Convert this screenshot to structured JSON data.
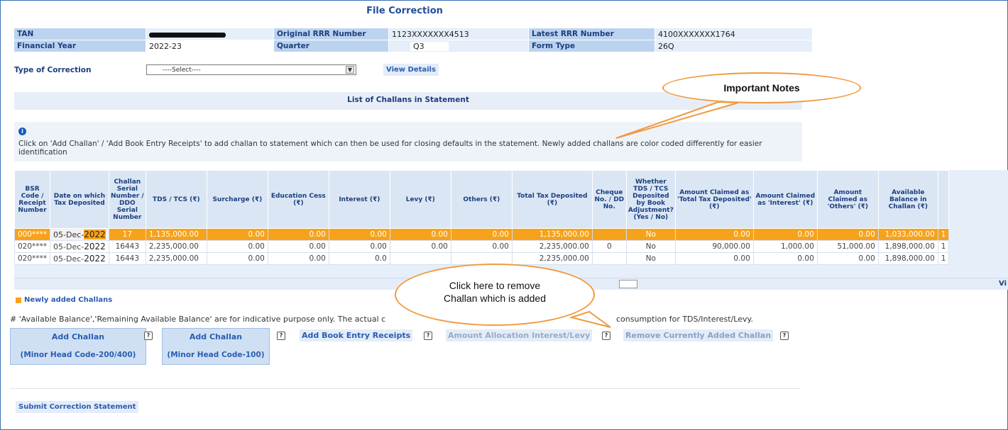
{
  "page": {
    "title": "File Correction"
  },
  "info": {
    "tan_label": "TAN",
    "tan_value": "",
    "orig_rrr_label": "Original RRR Number",
    "orig_rrr_value": "1123XXXXXXX4513",
    "latest_rrr_label": "Latest RRR Number",
    "latest_rrr_value": "4100XXXXXXX1764",
    "fy_label": "Financial Year",
    "fy_value": "2022-23",
    "quarter_label": "Quarter",
    "quarter_value": "Q3",
    "form_type_label": "Form Type",
    "form_type_value": "26Q"
  },
  "correction": {
    "label": "Type of Correction",
    "select_value": "----Select----",
    "view_details": "View Details"
  },
  "challan_header": "List of Challans in Statement",
  "note": "Click on 'Add Challan' / 'Add Book Entry Receipts' to add challan to statement which can then be used for closing defaults in the statement. Newly added challans are color coded differently for easier identification",
  "table": {
    "headers": [
      "BSR Code / Receipt Number",
      "Date on which Tax Deposited",
      "Challan Serial Number / DDO Serial Number",
      "TDS / TCS (₹)",
      "Surcharge (₹)",
      "Education Cess (₹)",
      "Interest (₹)",
      "Levy (₹)",
      "Others (₹)",
      "Total Tax Deposited (₹)",
      "Cheque No. / DD No.",
      "Whether TDS / TCS Deposited by Book Adjustment? (Yes / No)",
      "Amount Claimed as 'Total Tax Deposited' (₹)",
      "Amount Claimed as 'Interest' (₹)",
      "Amount Claimed as 'Others' (₹)",
      "Available Balance in Challan (₹)"
    ],
    "rows": [
      {
        "bsr": "000****",
        "date": "05-Dec-",
        "year": "2022",
        "serial": "17",
        "tds": "1,135,000.00",
        "surcharge": "0.00",
        "cess": "0.00",
        "interest": "0.00",
        "levy": "0.00",
        "others": "0.00",
        "total": "1,135,000.00",
        "cheque": "",
        "book": "No",
        "claimed_total": "0.00",
        "claimed_interest": "0.00",
        "claimed_others": "0.00",
        "available": "1,033,000.00",
        "extra": "1"
      },
      {
        "bsr": "020****",
        "date": "05-Dec-",
        "year": "2022",
        "serial": "16443",
        "tds": "2,235,000.00",
        "surcharge": "0.00",
        "cess": "0.00",
        "interest": "0.00",
        "levy": "0.00",
        "others": "0.00",
        "total": "2,235,000.00",
        "cheque": "0",
        "book": "No",
        "claimed_total": "90,000.00",
        "claimed_interest": "1,000.00",
        "claimed_others": "51,000.00",
        "available": "1,898,000.00",
        "extra": "1"
      },
      {
        "bsr": "020****",
        "date": "05-Dec-",
        "year": "2022",
        "serial": "16443",
        "tds": "2,235,000.00",
        "surcharge": "0.00",
        "cess": "0.00",
        "interest": "0.0",
        "levy": "",
        "others": "",
        "total": "2,235,000.00",
        "cheque": "",
        "book": "No",
        "claimed_total": "0.00",
        "claimed_interest": "0.00",
        "claimed_others": "0.00",
        "available": "1,898,000.00",
        "extra": "1"
      }
    ],
    "scroll_label": "Vi"
  },
  "legend": "Newly added Challans",
  "disclaimer_left": "# 'Available Balance','Remaining Available Balance' are for indicative purpose only. The actual c",
  "disclaimer_right": "consumption for TDS/Interest/Levy.",
  "actions": {
    "add_challan_1_line1": "Add Challan",
    "add_challan_1_line2": "(Minor Head Code-200/400)",
    "add_challan_2_line1": "Add Challan",
    "add_challan_2_line2": "(Minor Head Code-100)",
    "add_book_entry": "Add Book Entry Receipts",
    "amount_allocation": "Amount Allocation Interest/Levy",
    "remove_challan": "Remove Currently Added Challan",
    "help": "?"
  },
  "submit": "Submit Correction Statement",
  "callouts": {
    "notes": "Important Notes",
    "remove_line1": "Click here to remove",
    "remove_line2": "Challan which is added"
  },
  "colors": {
    "accent": "#2a5db0",
    "new_row": "#f7a21b",
    "callout_border": "#f09a3e",
    "header_bg": "#bcd3f0"
  }
}
